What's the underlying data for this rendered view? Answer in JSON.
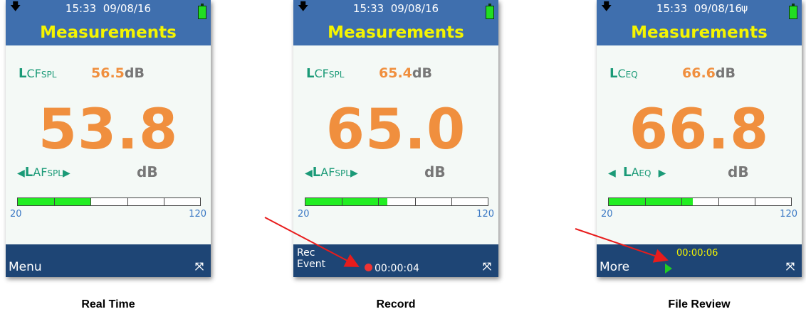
{
  "screens": [
    {
      "time": "15:33",
      "date": "09/08/16",
      "usb": false,
      "title": "Measurements",
      "secondary": {
        "L": "L",
        "sub": "CF",
        "sub_small": "SPL",
        "value": "56.5",
        "unit": "dB"
      },
      "primary_value": "53.8",
      "primary": {
        "L": "L",
        "sub": "AF",
        "sub_small": "SPL",
        "unit": "dB"
      },
      "bar_level_fraction": 0.4,
      "scale": {
        "min": "20",
        "max": "120"
      },
      "bottom_label": "Menu",
      "caption": "Real Time"
    },
    {
      "time": "15:33",
      "date": "09/08/16",
      "usb": false,
      "title": "Measurements",
      "secondary": {
        "L": "L",
        "sub": "CF",
        "sub_small": "SPL",
        "value": "65.4",
        "unit": "dB"
      },
      "primary_value": "65.0",
      "primary": {
        "L": "L",
        "sub": "AF",
        "sub_small": "SPL",
        "unit": "dB"
      },
      "bar_level_fraction": 0.45,
      "scale": {
        "min": "20",
        "max": "120"
      },
      "bottom_label_1": "Rec",
      "bottom_label_2": "Event",
      "rec_time": "00:00:04",
      "caption": "Record"
    },
    {
      "time": "15:33",
      "date": "09/08/16",
      "usb": true,
      "title": "Measurements",
      "secondary": {
        "L": "L",
        "sub": "C",
        "sub_small": "EQ",
        "value": "66.6",
        "unit": "dB"
      },
      "primary_value": "66.8",
      "primary": {
        "L": "L",
        "sub": "A",
        "sub_small": "EQ",
        "unit": "dB"
      },
      "bar_level_fraction": 0.46,
      "scale": {
        "min": "20",
        "max": "120"
      },
      "bottom_label": "More",
      "play_time": "00:00:06",
      "caption": "File Review"
    }
  ],
  "icons": {
    "download": "download-arrow-icon",
    "battery": "battery-icon",
    "usb": "usb-icon",
    "shuffle": "shuffle-icon",
    "record": "record-dot-icon",
    "play": "play-icon"
  },
  "colors": {
    "topbar": "#3f6fae",
    "bottombar": "#1e4575",
    "title": "#f4f400",
    "value": "#f08f3e",
    "label": "#1a9a77",
    "bar_fill": "#22ee22",
    "arrow": "#e81c1c"
  }
}
